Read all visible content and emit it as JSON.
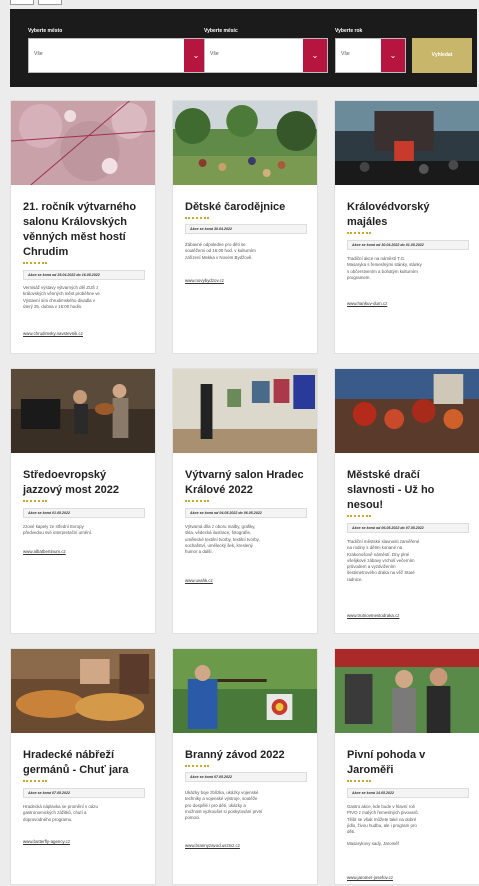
{
  "filters": {
    "city": {
      "label": "Vyberte město",
      "value": "Vše"
    },
    "month": {
      "label": "Vyberte měsíc",
      "value": "Vše"
    },
    "year": {
      "label": "Vyberte rok",
      "value": "Vše"
    },
    "submit_label": "Vyhledat"
  },
  "events": [
    {
      "title_lines": [
        "21. ročník výtvarného",
        "salonu Královských",
        "věnných měst hostí",
        "Chrudim"
      ],
      "date": "Akce se koná od 25.04.2022 do 16.05.2022",
      "desc_lines": [
        "Vernisáž výstavy výtvarných děl ZUŠ z",
        "královských věnných měst proběhne ve",
        "Výstavní síni chrudimského divadla v",
        "úterý 25. dubna v 16:00 hodin."
      ],
      "link": "www.chrudimsky.navstevnik.cz"
    },
    {
      "title_lines": [
        "Dětské čarodějnice"
      ],
      "date": "Akce se koná 30.04.2022",
      "desc_lines": [
        "Zábavné odpoledne pro děti se",
        "soutěžemi od 16:00 hod. v kulturním",
        "zařízení Mekka v Novém Bydžově."
      ],
      "link": "www.novybydzov.cz"
    },
    {
      "title_lines": [
        "Královédvorský",
        "majáles"
      ],
      "date": "Akce se koná od 30.04.2022 do 01.05.2022",
      "desc_lines": [
        "Tradiční akce na náměstí T.G.",
        "Masaryka s řemeslnými stánky, stánky",
        "s občerstvením a bohatým kulturním",
        "programem."
      ],
      "link": "www.hankuv-dum.cz"
    },
    {
      "title_lines": [
        "Středoevropský",
        "jazzový most 2022"
      ],
      "date": "Akce se koná 01.05.2022",
      "desc_lines": [
        "zzové kapely ze střední Evropy",
        "předvedou své interpretační umění."
      ],
      "link": "www.albatbertinum.cz"
    },
    {
      "title_lines": [
        "Výtvarný salon Hradec",
        "Králové 2022"
      ],
      "date": "Akce se koná od 04.05.2022 do 06.05.2022",
      "desc_lines": [
        "Výtvarná díla z oboru malby, grafiky,",
        "skla, vědecká ilustrace, fotografie,",
        "umělecké textilní tvorby, textilní tvorby,",
        "sochařství, umělecký šek, kreslený",
        "humor a další."
      ],
      "link": "www.uvahk.cz"
    },
    {
      "title_lines": [
        "Městské dračí",
        "slavnosti - Už ho",
        "nesou!"
      ],
      "date": "Akce se koná od 06.05.2022 do 07.05.2022",
      "desc_lines": [
        "Tradiční městské slavnosti zaměřené",
        "na rodiny s dětmi konané na",
        "Krakonošově náměstí. Dny plné",
        "všelijkové zábavy vrcholí večerním",
        "průvodem a vyzdvižením",
        "šestimetrového draka na věž Staré",
        "radnice."
      ],
      "link": "www.trutnovmestodraka.cz"
    },
    {
      "title_lines": [
        "Hradecké nábřeží",
        "germánů - Chuť jara"
      ],
      "date": "Akce se koná 07.05.2022",
      "desc_lines": [
        "Hradecká náplavka se promění v oázu",
        "gastronomických zážitků, chutí a",
        "doprovodného programu."
      ],
      "link": "www.butterfly-agency.cz"
    },
    {
      "title_lines": [
        "Branný závod 2022"
      ],
      "date": "Akce se koná 07.05.2022",
      "desc_lines": [
        "Ukázky boje zblízka, ukázky vojenské",
        "techniky a vojenské výstroje, soutěže",
        "pro dospělé i pro děti, ukázky a",
        "možnost vyzkoušet si poskytování první",
        "pomoci."
      ],
      "link": "www.brannyzavod.usztvz.cz"
    },
    {
      "title_lines": [
        "Pivní pohoda v",
        "Jaroměři"
      ],
      "date": "Akce se koná 14.05.2022",
      "desc_lines": [
        "Gastro akce, kde bude v hlavní roli",
        "PIVO z malých řemeslných pivovarů.",
        "Těšit se však můžete také na dobré",
        "jídlo, živou hudbu, ale i program pro",
        "děti.",
        "",
        "Masarykovy sady, Jaroměř"
      ],
      "link": "www.jaromer-josefov.cz"
    }
  ],
  "colors": {
    "accent": "#b5153f",
    "gold": "#c8b76a",
    "bar": "#1b1b1b"
  }
}
